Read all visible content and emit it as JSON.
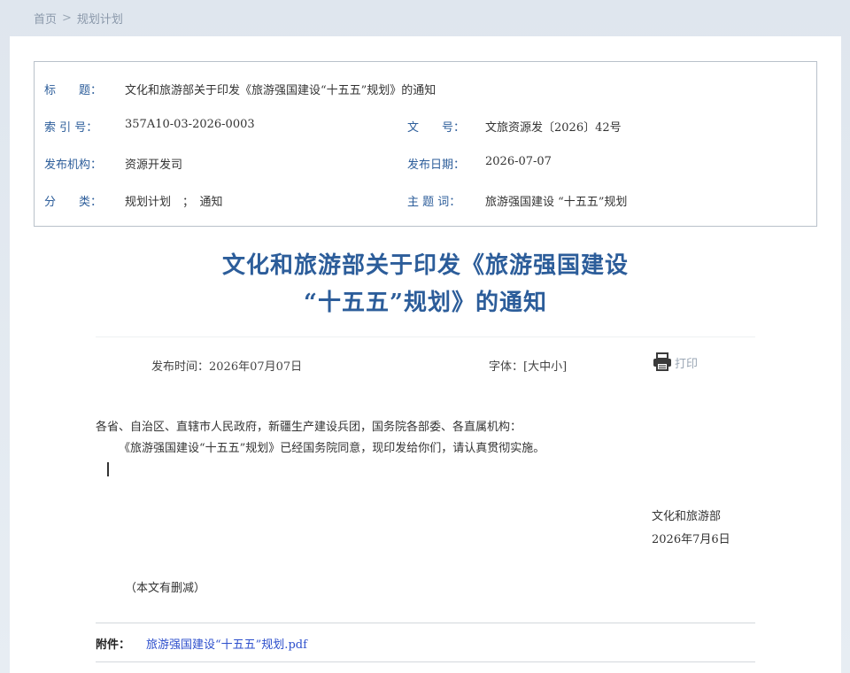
{
  "breadcrumb": {
    "home": "首页",
    "sep": ">",
    "current": "规划计划"
  },
  "meta": {
    "title_key": "标　　题：",
    "title_val": "文化和旅游部关于印发《旅游强国建设“十五五”规划》的通知",
    "index_key": "索 引 号：",
    "index_val": "357A10-03-2026-0003",
    "docno_key": "文　　号：",
    "docno_val": "文旅资源发〔2026〕42号",
    "org_key": "发布机构：",
    "org_val": "资源开发司",
    "date_key": "发布日期：",
    "date_val": "2026-07-07",
    "cat_key": "分　　类：",
    "cat_val": "规划计划　；　通知",
    "topic_key": "主 题 词：",
    "topic_val": "旅游强国建设 “十五五”规划"
  },
  "article": {
    "title_line1": "文化和旅游部关于印发《旅游强国建设",
    "title_line2": "“十五五”规划》的通知",
    "pubtime": "发布时间：2026年07月07日",
    "font_label": "字体：",
    "font_open": "[",
    "font_large": "大",
    "font_medium": "中",
    "font_small": "小",
    "font_close": "]",
    "print_label": "打印",
    "recipients": "各省、自治区、直辖市人民政府，新疆生产建设兵团，国务院各部委、各直属机构：",
    "body": "《旅游强国建设“十五五”规划》已经国务院同意，现印发给你们，请认真贯彻实施。",
    "signer": "文化和旅游部",
    "sign_date": "2026年7月6日",
    "note": "（本文有删减）",
    "attach_key": "附件：",
    "attach_file": "旅游强国建设“十五五”规划.pdf"
  },
  "colors": {
    "accent": "#2c5d9a",
    "link": "#2d4fcc",
    "muted": "#9aa6b4"
  },
  "icons": {
    "print": "printer-icon"
  }
}
